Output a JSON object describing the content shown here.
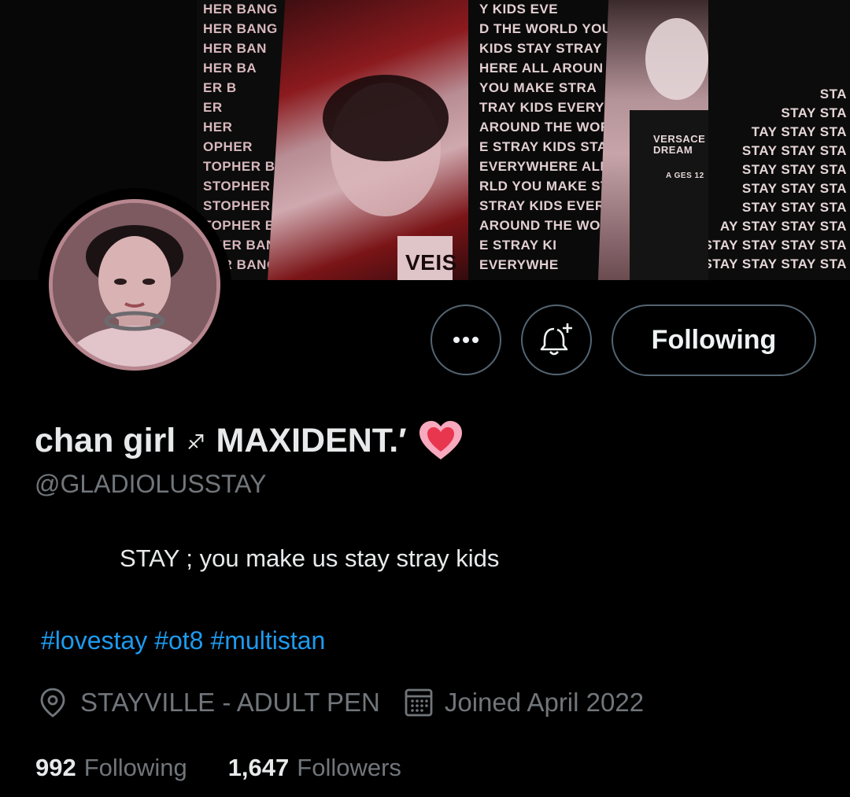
{
  "banner": {
    "panel_1_lines": [
      "HER BANG",
      "HER BANG",
      "HER BAN",
      "HER BA",
      "ER B",
      "ER",
      "HER",
      "OPHER",
      "TOPHER BA",
      "STOPHER BANG",
      "STOPHER BANG",
      "TOPHER BANG CH",
      "PHER BANG CHA",
      "HER BANG CHA"
    ],
    "panel_2_lines": [
      "Y KIDS EVE",
      "D THE WORLD YOU",
      "KIDS STAY STRAY",
      "HERE ALL AROUN",
      "YOU MAKE STRA",
      "TRAY KIDS EVERY",
      "AROUND THE WORL",
      "E STRAY KIDS STAY",
      "EVERYWHERE ALL ARO",
      "RLD YOU MAKE STRAY",
      "STRAY KIDS EVERYWH",
      "AROUND THE WORLD",
      "E STRAY KI",
      "EVERYWHE"
    ],
    "panel_3_lines": [
      "STA",
      "STAY STA",
      "TAY STAY STA",
      "STAY STAY STA",
      "STAY STAY STA",
      "STAY STAY STA",
      "STAY STAY STA",
      "AY STAY STAY STA",
      "STAY STAY STAY STA",
      "TAY STAY STAY STAY STA"
    ],
    "shirt_text": "VERSACE DREAM",
    "shirt_sub": "A GES 12",
    "sign_text": "VEIS"
  },
  "actions": {
    "more_label": "More",
    "notify_label": "Notifications",
    "following_label": "Following"
  },
  "profile": {
    "display_name": "chan girl",
    "name_symbol": "♐",
    "name_suffix": "MAXIDENT.′",
    "name_emoji": "💗",
    "handle": "@GLADIOLUSSTAY",
    "bio": "STAY ; you make us stay stray kids",
    "hashtags": [
      "#lovestay",
      "#ot8",
      "#multistan"
    ],
    "location": "STAYVILLE - ADULT PEN",
    "joined": "Joined April 2022"
  },
  "stats": {
    "following_count": "992",
    "following_label": "Following",
    "followers_count": "1,647",
    "followers_label": "Followers"
  },
  "colors": {
    "background": "#000000",
    "primary_text": "#e7e9ea",
    "secondary_text": "#71767b",
    "link": "#1d9bf0",
    "border": "#536471",
    "banner_pink": "#c9a3a8",
    "banner_red": "#8b1a1e"
  },
  "icons": {
    "more": "more-dots-icon",
    "notify": "bell-plus-icon",
    "location": "location-pin-icon",
    "calendar": "calendar-icon"
  }
}
